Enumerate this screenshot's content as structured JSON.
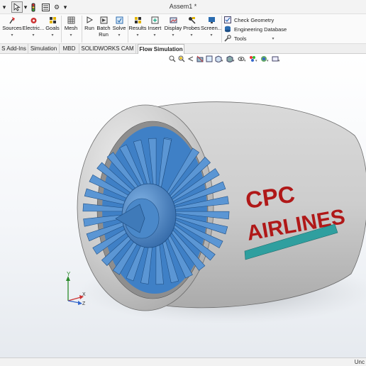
{
  "title_bar": {
    "document_title": "Assem1 *",
    "quick_access": [
      {
        "name": "arrow-down-icon",
        "glyph": "▾"
      },
      {
        "name": "select-cursor-icon",
        "glyph": "⬉"
      },
      {
        "name": "arrow-down-icon",
        "glyph": "▾"
      },
      {
        "name": "traffic-light-icon",
        "glyph": "●"
      },
      {
        "name": "file-properties-icon",
        "glyph": "▤"
      },
      {
        "name": "options-gear-icon",
        "glyph": "⚙"
      },
      {
        "name": "arrow-down-icon",
        "glyph": "▾"
      }
    ]
  },
  "ribbon": {
    "buttons": [
      {
        "id": "sources",
        "label": "Sources",
        "icon": "sources-icon",
        "arrow": "▾"
      },
      {
        "id": "electric",
        "label": "Electric...",
        "icon": "electric-icon",
        "arrow": "▾"
      },
      {
        "id": "goals",
        "label": "Goals",
        "icon": "goals-icon",
        "arrow": "▾"
      },
      {
        "id": "mesh",
        "label": "Mesh",
        "icon": "mesh-icon",
        "arrow": "▾"
      },
      {
        "id": "run",
        "label": "Run",
        "icon": "run-icon",
        "arrow": ""
      },
      {
        "id": "batch_run",
        "label": "Batch Run",
        "icon": "batch-run-icon",
        "arrow": ""
      },
      {
        "id": "solve",
        "label": "Solve",
        "icon": "solve-icon",
        "arrow": "▾"
      },
      {
        "id": "results",
        "label": "Results",
        "icon": "results-icon",
        "arrow": "▾"
      },
      {
        "id": "insert",
        "label": "Insert",
        "icon": "insert-icon",
        "arrow": "▾"
      },
      {
        "id": "display",
        "label": "Display",
        "icon": "display-icon",
        "arrow": "▾"
      },
      {
        "id": "probes",
        "label": "Probes",
        "icon": "probes-icon",
        "arrow": "▾"
      },
      {
        "id": "screen",
        "label": "Screen...",
        "icon": "screen-icon",
        "arrow": "▾"
      }
    ],
    "side_items": [
      {
        "id": "check_geometry",
        "label": "Check Geometry",
        "icon": "check-geometry-icon"
      },
      {
        "id": "engineering_database",
        "label": "Engineering Database",
        "icon": "engineering-database-icon"
      },
      {
        "id": "tools",
        "label": "Tools",
        "icon": "tools-icon"
      }
    ],
    "side_arrow": "▾"
  },
  "tabs": [
    {
      "label": "S Add-Ins",
      "active": false
    },
    {
      "label": "Simulation",
      "active": false
    },
    {
      "label": "MBD",
      "active": false
    },
    {
      "label": "SOLIDWORKS CAM",
      "active": false
    },
    {
      "label": "Flow Simulation",
      "active": true
    }
  ],
  "viewport": {
    "model_text": {
      "line1": "CPC",
      "line2": "AIRLINES"
    },
    "triad": {
      "y": "Y",
      "x": "X",
      "z": "Z"
    },
    "colors": {
      "nacelle": "#c7c7c7",
      "fan": "#3f80c6",
      "text": "#b01818",
      "stripe": "#2f9f9f"
    },
    "headsup_icons": [
      "zoom-to-fit-icon",
      "zoom-to-area-icon",
      "previous-view-icon",
      "section-view-icon",
      "dynamic-annotation-icon",
      "view-orientation-icon",
      "display-style-icon",
      "hide-show-icon",
      "edit-appearance-icon",
      "apply-scene-icon",
      "view-settings-icon"
    ]
  },
  "status_bar": {
    "text": "Unc"
  }
}
